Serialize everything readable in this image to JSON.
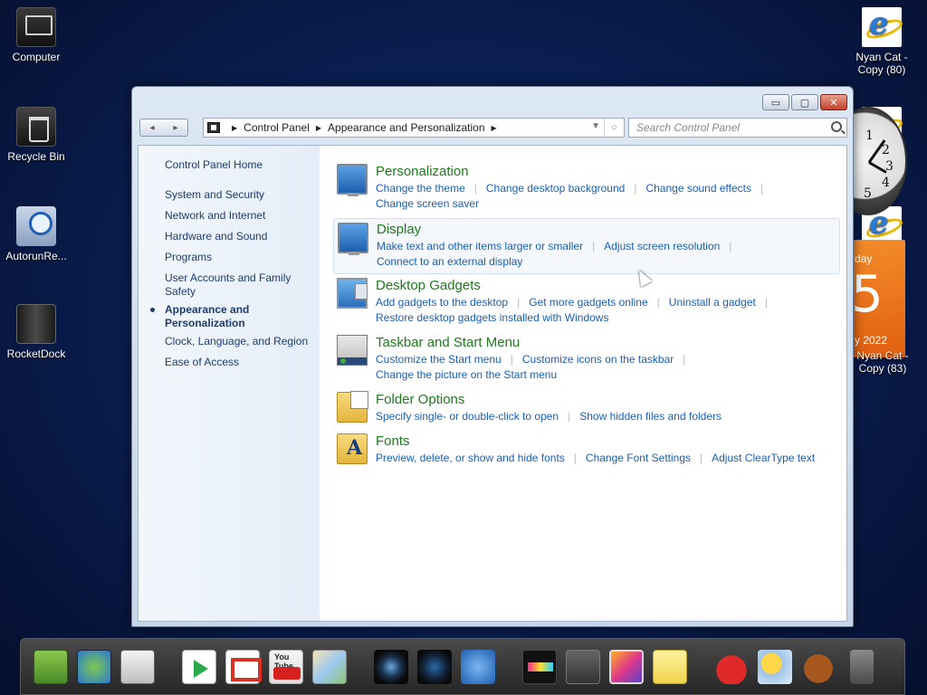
{
  "desktop": {
    "icons_left": [
      {
        "label": "Computer"
      },
      {
        "label": "Recycle Bin"
      },
      {
        "label": "AutorunRe..."
      },
      {
        "label": "RocketDock"
      }
    ],
    "icons_right": [
      {
        "line1": "Nyan Cat -",
        "line2": "Copy (80)"
      },
      {
        "line1": "Nyan Cat -",
        "line2": "Copy (83)"
      }
    ]
  },
  "gadgets": {
    "clock_numbers": [
      "1",
      "2",
      "3",
      "4",
      "5"
    ],
    "calendar": {
      "day": "day",
      "date": "5",
      "year": "y 2022"
    }
  },
  "window": {
    "controls": {
      "minimize": "▭",
      "maximize": "▢",
      "close": "✕"
    },
    "nav": {
      "back": "◂",
      "forward": "▸"
    },
    "breadcrumb": [
      "Control Panel",
      "Appearance and Personalization"
    ],
    "search": {
      "placeholder": "Search Control Panel"
    },
    "sidebar": {
      "home": "Control Panel Home",
      "items": [
        {
          "label": "System and Security"
        },
        {
          "label": "Network and Internet"
        },
        {
          "label": "Hardware and Sound"
        },
        {
          "label": "Programs"
        },
        {
          "label": "User Accounts and Family Safety"
        },
        {
          "label": "Appearance and Personalization",
          "active": true
        },
        {
          "label": "Clock, Language, and Region"
        },
        {
          "label": "Ease of Access"
        }
      ]
    },
    "categories": [
      {
        "title": "Personalization",
        "icon": "personalization-icon",
        "links": [
          "Change the theme",
          "Change desktop background",
          "Change sound effects",
          "Change screen saver"
        ]
      },
      {
        "title": "Display",
        "icon": "display-icon",
        "highlighted": true,
        "links": [
          "Make text and other items larger or smaller",
          "Adjust screen resolution",
          "Connect to an external display"
        ]
      },
      {
        "title": "Desktop Gadgets",
        "icon": "gadgets-icon",
        "links": [
          "Add gadgets to the desktop",
          "Get more gadgets online",
          "Uninstall a gadget",
          "Restore desktop gadgets installed with Windows"
        ]
      },
      {
        "title": "Taskbar and Start Menu",
        "icon": "taskbar-icon",
        "links": [
          "Customize the Start menu",
          "Customize icons on the taskbar",
          "Change the picture on the Start menu"
        ]
      },
      {
        "title": "Folder Options",
        "icon": "folder-options-icon",
        "links": [
          "Specify single- or double-click to open",
          "Show hidden files and folders"
        ]
      },
      {
        "title": "Fonts",
        "icon": "fonts-icon",
        "links": [
          "Preview, delete, or show and hide fonts",
          "Change Font Settings",
          "Adjust ClearType text"
        ]
      }
    ]
  },
  "dock": {
    "items": [
      "android-folder-icon",
      "globe-folder-icon",
      "android-icon",
      "play-store-icon",
      "gmail-icon",
      "youtube-icon",
      "maps-icon",
      "speaker-icon",
      "speaker-alt-icon",
      "internet-explorer-icon",
      "media-tv-icon",
      "calculator-icon",
      "photos-icon",
      "sticky-notes-icon",
      "angry-birds-icon",
      "weather-icon",
      "gingerbread-icon",
      "trash-icon"
    ],
    "youtube_label": "You Tube"
  },
  "colors": {
    "link": "#1a5fb4",
    "category_title": "#1f7a1f",
    "desktop_bg": "#0a1f52"
  }
}
